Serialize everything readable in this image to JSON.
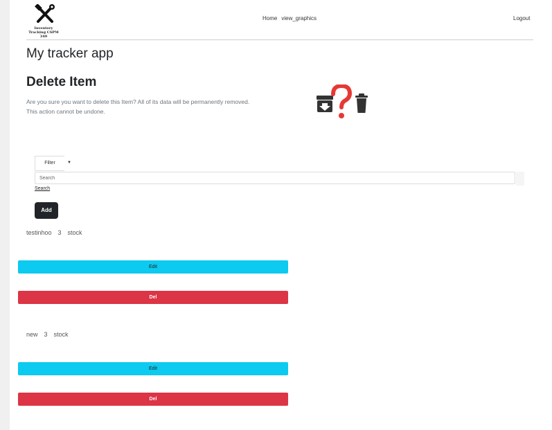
{
  "header": {
    "logo_text": "Inventory Tracking CSPM 349",
    "nav": [
      "Home",
      "view_graphics"
    ],
    "logout": "Logout"
  },
  "app_title": "My tracker app",
  "section": {
    "title": "Delete Item",
    "description": "Are you sure you want to delete this Item? All of its data will be permanently removed. This action cannot be undone."
  },
  "filter": {
    "label": "Filter",
    "caret": "▼"
  },
  "search": {
    "placeholder": "Search",
    "link": "Search"
  },
  "add_label": "Add",
  "items": [
    {
      "name": "testinhoo",
      "qty": "3",
      "type": "stock",
      "edit": "Edit",
      "del": "Del"
    },
    {
      "name": "new",
      "qty": "3",
      "type": "stock",
      "edit": "Edit",
      "del": "Del"
    }
  ],
  "colors": {
    "edit": "#0dcaf0",
    "del": "#dc3545",
    "add": "#212529",
    "question": "#e53935"
  }
}
